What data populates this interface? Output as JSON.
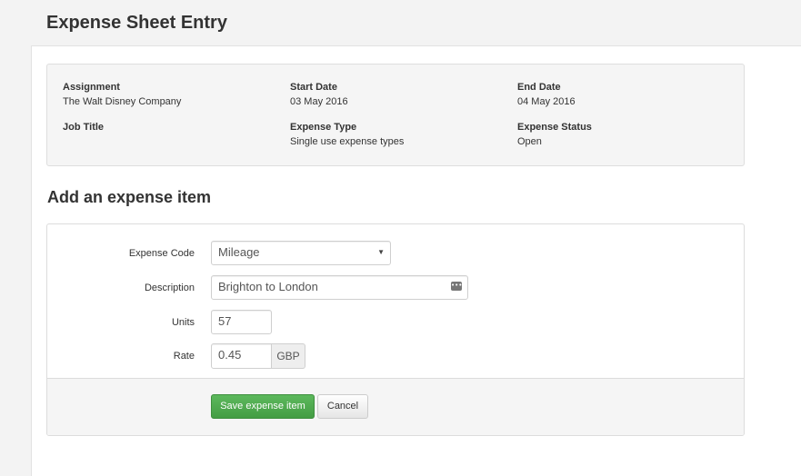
{
  "page": {
    "title": "Expense Sheet Entry"
  },
  "summary": {
    "assignment_label": "Assignment",
    "assignment_value": "The Walt Disney Company",
    "start_date_label": "Start Date",
    "start_date_value": "03 May 2016",
    "end_date_label": "End Date",
    "end_date_value": "04 May 2016",
    "job_title_label": "Job Title",
    "job_title_value": "",
    "expense_type_label": "Expense Type",
    "expense_type_value": "Single use expense types",
    "expense_status_label": "Expense Status",
    "expense_status_value": "Open"
  },
  "form": {
    "section_title": "Add an expense item",
    "expense_code_label": "Expense Code",
    "expense_code_value": "Mileage",
    "description_label": "Description",
    "description_value": "Brighton to London",
    "units_label": "Units",
    "units_value": "57",
    "rate_label": "Rate",
    "rate_value": "0.45",
    "rate_currency": "GBP",
    "save_label": "Save expense item",
    "cancel_label": "Cancel"
  },
  "icons": {
    "select_arrow": "chevron-down-icon",
    "description_helper": "more-dots-icon"
  },
  "colors": {
    "save_button": "#5cb85c",
    "panel_background": "#f5f5f5"
  }
}
